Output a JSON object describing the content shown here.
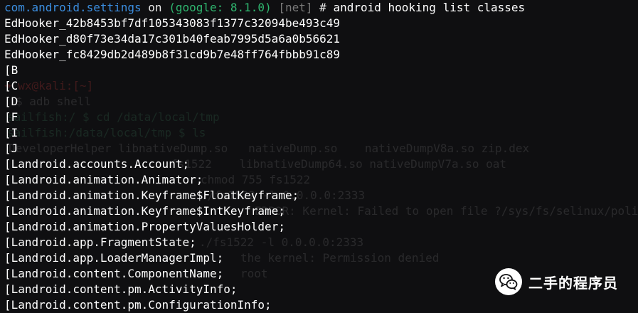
{
  "prompt": {
    "package": "com.android.settings",
    "on_word": "on",
    "device": "(google: 8.1.0)",
    "net_tag": "[net]",
    "hash": "#",
    "command": "android hooking list classes"
  },
  "output_lines": [
    "EdHooker_42b8453bf7df105343083f1377c32094be493c49",
    "EdHooker_d80f73e34da17c301b40feab7995d5a6a0b56621",
    "EdHooker_fc8429db2d489b8f31cd9b7e48ff764fbbb91c89",
    "[B",
    "[C",
    "[D",
    "[F",
    "[I",
    "[J",
    "[Landroid.accounts.Account;",
    "[Landroid.animation.Animator;",
    "[Landroid.animation.Keyframe$FloatKeyframe;",
    "[Landroid.animation.Keyframe$IntKeyframe;",
    "[Landroid.animation.PropertyValuesHolder;",
    "[Landroid.app.FragmentState;",
    "[Landroid.app.LoaderManagerImpl;",
    "[Landroid.content.ComponentName;",
    "[Landroid.content.pm.ActivityInfo;",
    "[Landroid.content.pm.ConfigurationInfo;"
  ],
  "ghost_lines": [
    "➜ wx@kali:[~]",
    "$ adb shell",
    "sailfish:/ $ cd /data/local/tmp",
    "sailfish:/data/local/tmp $ ls",
    "DeveloperHelper libnativeDump.so   nativeDump.so    nativeDumpV8a.so zip.dex",
    "fs1522    libnativeDump64.so nativeDumpV7a.so oat",
    "chmod 755 fs1522",
    "./fs1522 -l 0.0.0.0:2333",
    "ERROR: Kernel: Failed to open file ?/sys/fs/selinux/polic",
    "./fs1522 -l 0.0.0.0:2333",
    "the kernel: Permission denied",
    "root"
  ],
  "watermark": {
    "icon": "wechat-icon",
    "text": "二手的程序员"
  },
  "colors": {
    "background": "#0f0f11",
    "package": "#3b8ee0",
    "device": "#2fb66f",
    "net": "#7a7a7a",
    "text": "#ffffff"
  }
}
